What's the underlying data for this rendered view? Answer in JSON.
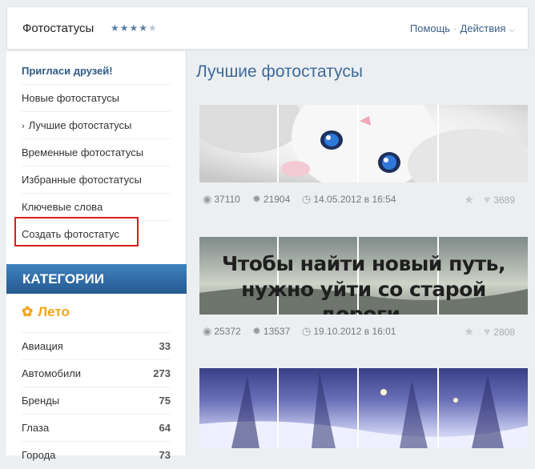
{
  "header": {
    "title": "Фотостатусы",
    "rating_stars": "★★★★",
    "rating_empty": "★",
    "help": "Помощь",
    "separator": "·",
    "actions": "Действия",
    "actions_chevron": "⌵"
  },
  "sidebar": {
    "invite": "Пригласи друзей!",
    "items": [
      {
        "label": "Новые фотостатусы"
      },
      {
        "label": "Лучшие фотостатусы",
        "active_marker": "›"
      },
      {
        "label": "Временные фотостатусы"
      },
      {
        "label": "Избранные фотостатусы"
      },
      {
        "label": "Ключевые слова"
      },
      {
        "label": "Создать фотостатус"
      }
    ],
    "categories_title": "КАТЕГОРИИ",
    "season": "Лето",
    "season_icon": "✿",
    "categories": [
      {
        "name": "Авиация",
        "count": "33"
      },
      {
        "name": "Автомобили",
        "count": "273"
      },
      {
        "name": "Бренды",
        "count": "75"
      },
      {
        "name": "Глаза",
        "count": "64"
      },
      {
        "name": "Города",
        "count": "73"
      }
    ]
  },
  "main": {
    "title": "Лучшие фотостатусы",
    "posts": [
      {
        "views": "37110",
        "installs": "21904",
        "date": "14.05.2012 в 16:54",
        "likes": "3689"
      },
      {
        "views": "25372",
        "installs": "13537",
        "date": "19.10.2012 в 16:01",
        "likes": "2808",
        "quote_line1": "Чтобы найти новый путь,",
        "quote_line2": "нужно уйти со старой дороги."
      }
    ],
    "icons": {
      "views": "eye-icon",
      "installs": "gear-icon",
      "date": "clock-icon",
      "fav": "star-icon",
      "like": "heart-icon"
    }
  },
  "colors": {
    "accent": "#3e6b98",
    "category_header": "#2f6aa4",
    "season": "#f0a41c",
    "highlight": "#d41f1f"
  }
}
